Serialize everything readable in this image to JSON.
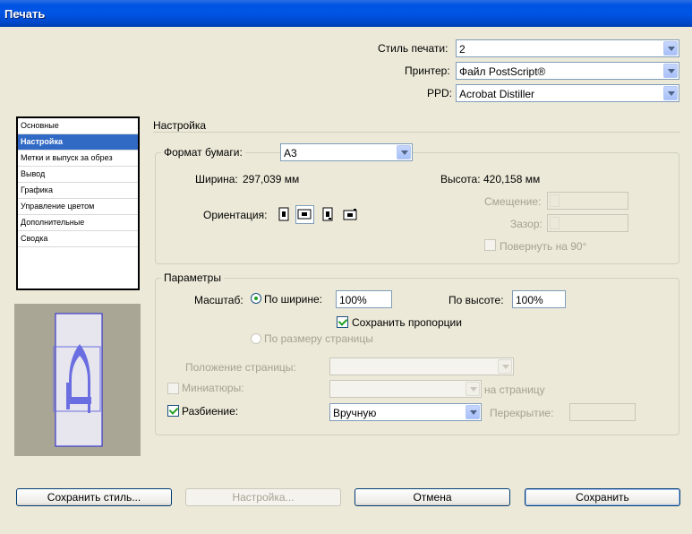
{
  "window": {
    "title": "Печать"
  },
  "top": {
    "style_label": "Стиль печати:",
    "style_value": "2",
    "printer_label": "Принтер:",
    "printer_value": "Файл PostScript®",
    "ppd_label": "PPD:",
    "ppd_value": "Acrobat Distiller"
  },
  "sidebar": {
    "items": [
      {
        "label": "Основные"
      },
      {
        "label": "Настройка"
      },
      {
        "label": "Метки и выпуск за обрез"
      },
      {
        "label": "Вывод"
      },
      {
        "label": "Графика"
      },
      {
        "label": "Управление цветом"
      },
      {
        "label": "Дополнительные"
      },
      {
        "label": "Сводка"
      }
    ],
    "selected": "Настройка"
  },
  "section": {
    "title": "Настройка"
  },
  "paper": {
    "legend": "Формат бумаги:",
    "format_value": "A3",
    "width_label": "Ширина:",
    "width_value": "297,039 мм",
    "height_label": "Высота:",
    "height_value": "420,158 мм",
    "orientation_label": "Ориентация:",
    "offset_label": "Смещение:",
    "gap_label": "Зазор:",
    "rotate_label": "Повернуть на 90°"
  },
  "params": {
    "legend": "Параметры",
    "scale_label": "Масштаб:",
    "by_width_label": "По ширине:",
    "by_width_value": "100%",
    "by_height_label": "По высоте:",
    "by_height_value": "100%",
    "keep_proportions_label": "Сохранить пропорции",
    "fit_page_label": "По размеру страницы",
    "page_position_label": "Положение страницы:",
    "thumbnails_label": "Миниатюры:",
    "per_page_label": "на страницу",
    "tiling_label": "Разбиение:",
    "tiling_value": "Вручную",
    "overlap_label": "Перекрытие:"
  },
  "buttons": {
    "save_style": "Сохранить стиль...",
    "setup": "Настройка...",
    "cancel": "Отмена",
    "save": "Сохранить"
  },
  "colors": {
    "accent": "#316ac5",
    "titlebar": "#0054e3",
    "preview_page": "#6b6ee0"
  }
}
